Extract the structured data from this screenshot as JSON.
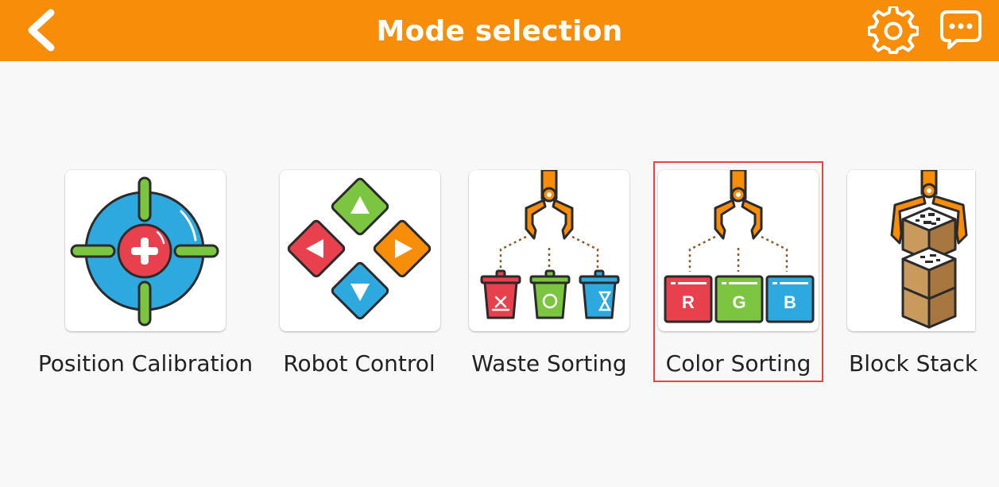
{
  "header": {
    "title": "Mode selection",
    "back_icon": "chevron-left-icon",
    "settings_icon": "gear-icon",
    "chat_icon": "chat-bubble-icon",
    "background_color": "#f78d08"
  },
  "modes": [
    {
      "label": "Position Calibration",
      "icon": "crosshair-target-icon"
    },
    {
      "label": "Robot Control",
      "icon": "direction-pad-icon"
    },
    {
      "label": "Waste Sorting",
      "icon": "gripper-trash-bins-icon"
    },
    {
      "label": "Color Sorting",
      "icon": "gripper-rgb-blocks-icon",
      "selected": true
    },
    {
      "label": "Block Stack",
      "icon": "gripper-stacked-blocks-icon"
    }
  ],
  "rgb_blocks": [
    "R",
    "G",
    "B"
  ],
  "colors": {
    "selected_outline": "#e8434a",
    "red": "#e8414d",
    "green": "#7cc540",
    "blue": "#2ea9e0",
    "orange": "#f78d08"
  }
}
